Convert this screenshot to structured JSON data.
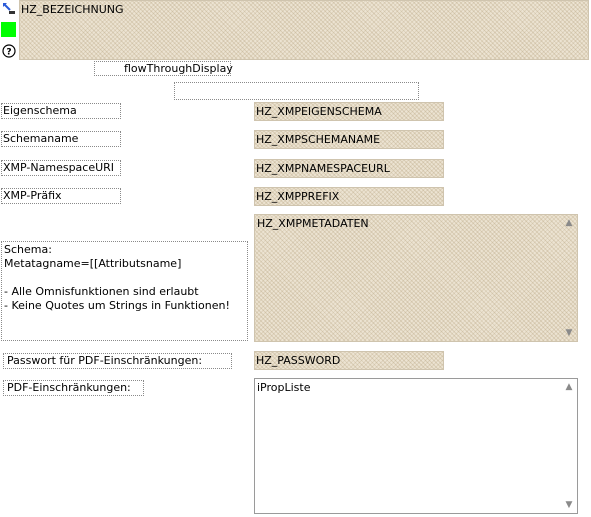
{
  "toolbar": {
    "icon_colors": {
      "swatch": "#00ff00",
      "link_icon": "#2a5ad8"
    }
  },
  "fields": {
    "bezeichnung": "HZ_BEZEICHNUNG",
    "flow_through": "flowThroughDisplay",
    "xmp_eigenschema": "HZ_XMPEIGENSCHEMA",
    "xmp_schemaname": "HZ_XMPSCHEMANAME",
    "xmp_namespaceurl": "HZ_XMPNAMESPACEURL",
    "xmp_prefix": "HZ_XMPPREFIX",
    "xmp_metadaten": "HZ_XMPMETADATEN",
    "password": "HZ_PASSWORD",
    "iprop_liste": "iPropListe"
  },
  "labels": {
    "eigenschema": "Eigenschema",
    "schemaname": "Schemaname",
    "namespace_uri": "XMP-NamespaceURI",
    "prefix": "XMP-Präfix",
    "schema_help": "Schema:\nMetatagname=[[Attributsname]\n\n- Alle Omnisfunktionen sind erlaubt\n- Keine Quotes um Strings in Funktionen!",
    "password": "Passwort für PDF-Einschränkungen:",
    "pdf_restrictions": "PDF-Einschränkungen:"
  },
  "scroll": {
    "up_arrow": "▲",
    "down_arrow": "▼"
  }
}
